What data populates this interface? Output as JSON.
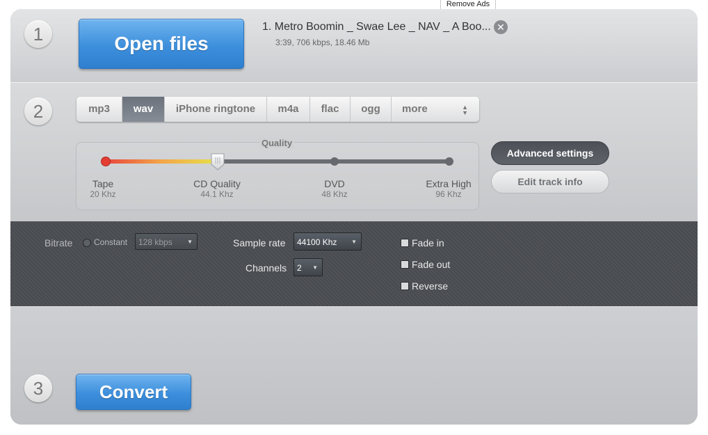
{
  "remove_ads": "Remove Ads",
  "steps": {
    "s1": "1",
    "s2": "2",
    "s3": "3"
  },
  "open_files_label": "Open files",
  "file": {
    "name": "1. Metro Boomin _ Swae Lee _ NAV _ A Boo...",
    "meta": "3:39, 706 kbps, 18.46 Mb"
  },
  "format_tabs": [
    "mp3",
    "wav",
    "iPhone ringtone",
    "m4a",
    "flac",
    "ogg",
    "more"
  ],
  "active_format": "wav",
  "quality": {
    "title": "Quality",
    "selected": "CD Quality",
    "levels": [
      {
        "label": "Tape",
        "sub": "20 Khz"
      },
      {
        "label": "CD Quality",
        "sub": "44.1 Khz"
      },
      {
        "label": "DVD",
        "sub": "48 Khz"
      },
      {
        "label": "Extra High",
        "sub": "96 Khz"
      }
    ]
  },
  "buttons": {
    "advanced_settings": "Advanced settings",
    "edit_track_info": "Edit track info",
    "convert": "Convert"
  },
  "advanced": {
    "bitrate_label": "Bitrate",
    "bitrate_mode": "Constant",
    "bitrate_value": "128 kbps",
    "sample_rate_label": "Sample rate",
    "sample_rate_value": "44100 Khz",
    "channels_label": "Channels",
    "channels_value": "2",
    "fade_in": "Fade in",
    "fade_out": "Fade out",
    "reverse": "Reverse"
  },
  "colors": {
    "accent_blue": "#3d8fdc",
    "active_tab": "#737a84",
    "advanced_panel": "#4a4d52",
    "slider_red": "#e43d34",
    "slider_yellow": "#e6e24a"
  }
}
